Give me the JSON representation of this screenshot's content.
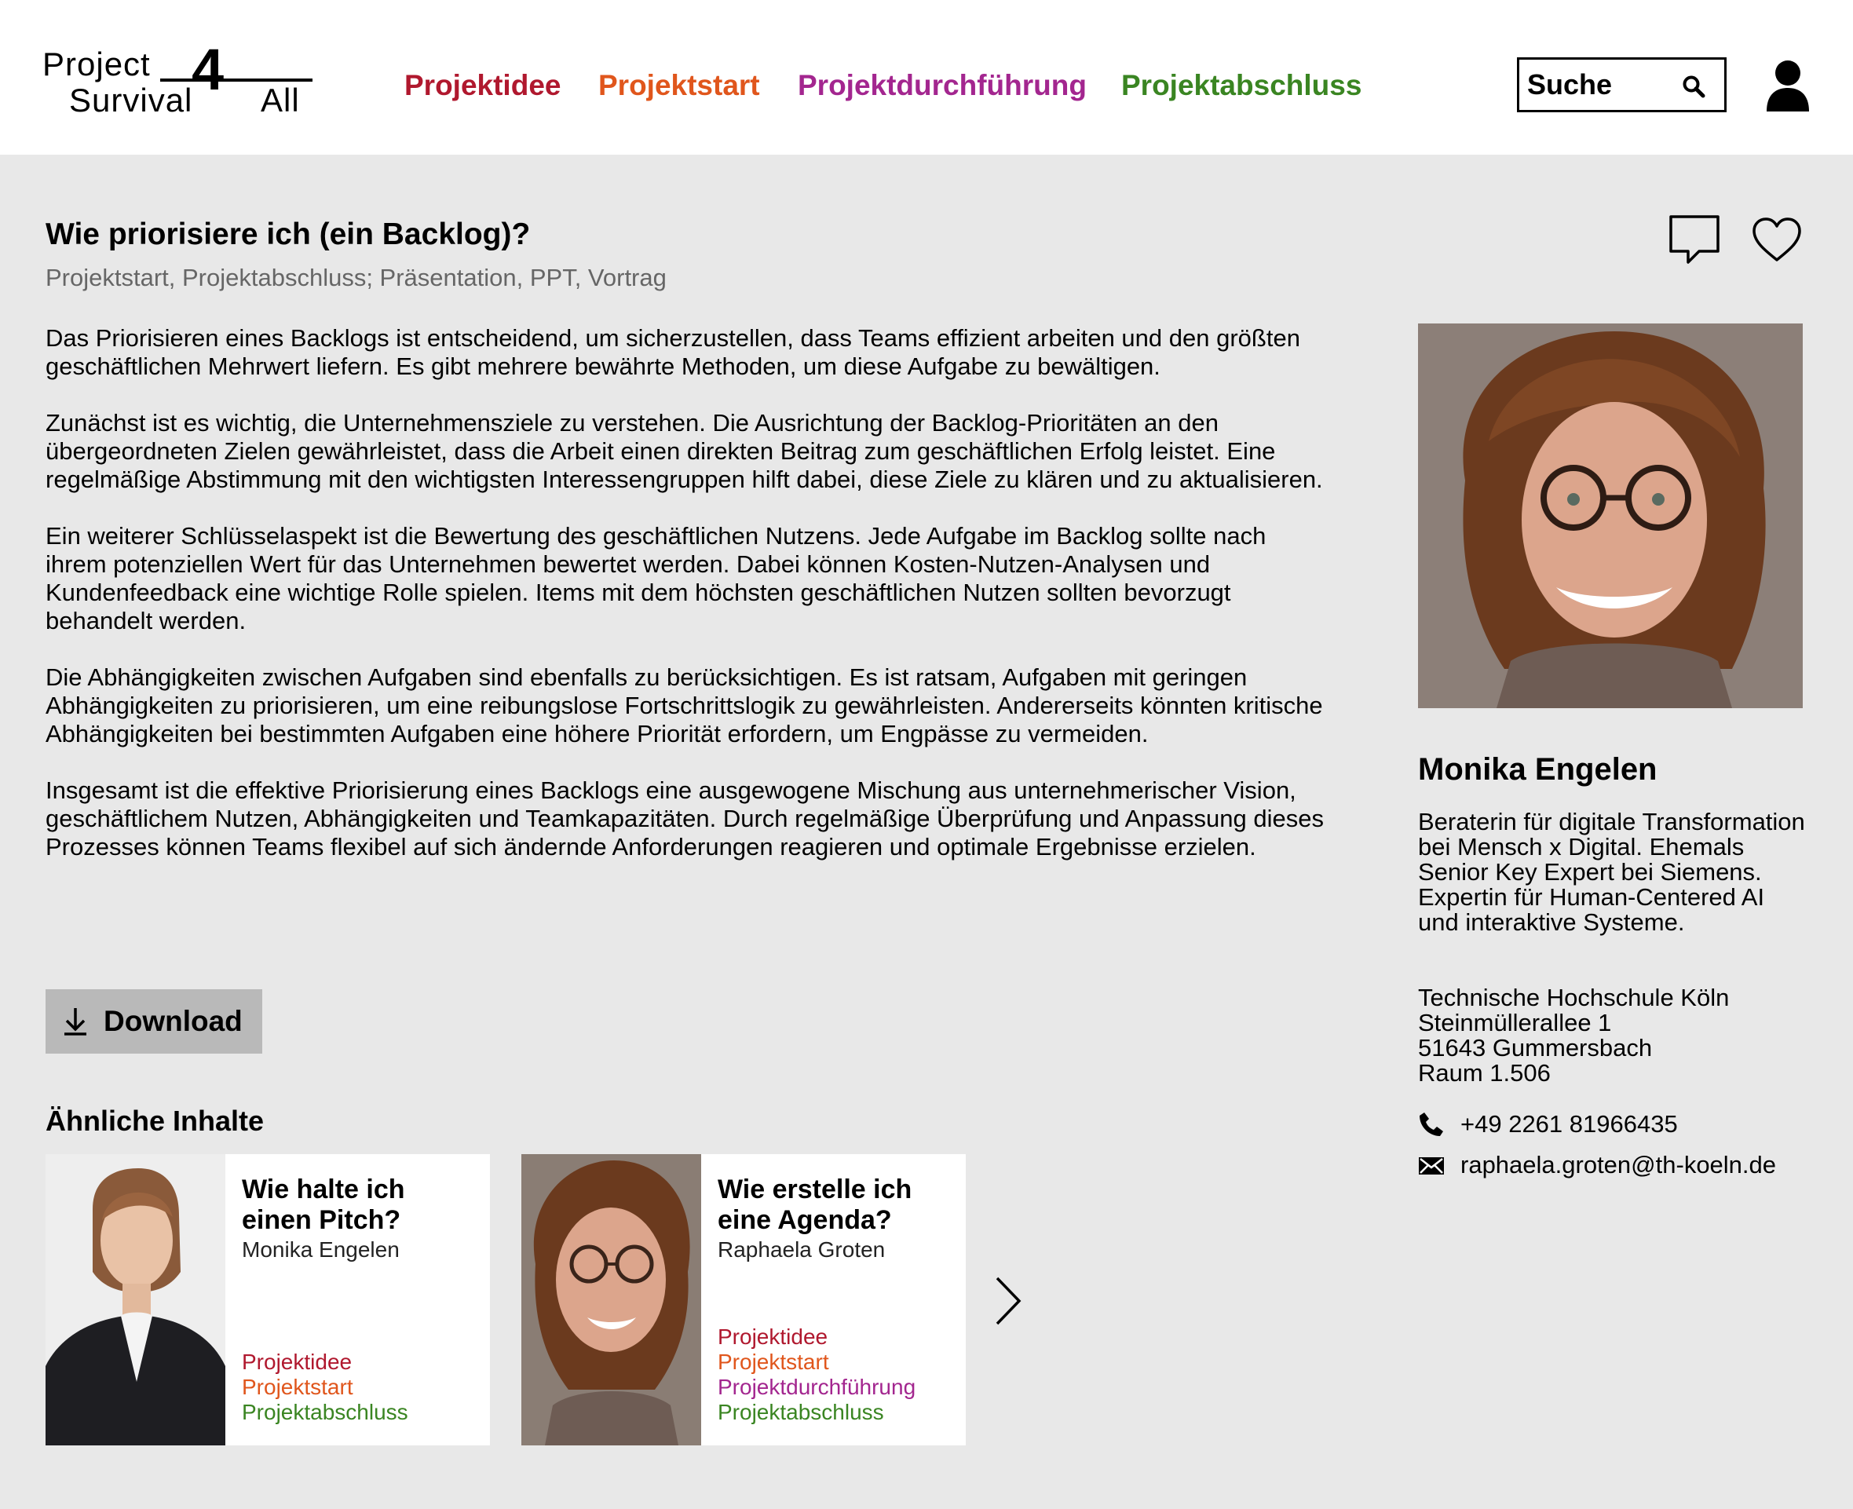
{
  "header": {
    "logo_line1": "Project",
    "logo_digit": "4",
    "logo_line2": "Survival",
    "logo_all": "All",
    "nav": [
      "Projektidee",
      "Projektstart",
      "Projektdurchführung",
      "Projektabschluss"
    ],
    "search_placeholder": "Suche"
  },
  "article": {
    "title": "Wie priorisiere ich (ein Backlog)?",
    "tags": "Projektstart, Projektabschluss; Präsentation, PPT, Vortrag",
    "paragraphs": [
      "Das Priorisieren eines Backlogs ist entscheidend, um sicherzustellen, dass Teams effizient arbeiten und den größten geschäftlichen Mehrwert liefern. Es gibt mehrere bewährte Methoden, um diese Aufgabe zu bewältigen.",
      "Zunächst ist es wichtig, die Unternehmensziele zu verstehen. Die Ausrichtung der Backlog-Prioritäten an den übergeordneten Zielen gewährleistet, dass die Arbeit einen direkten Beitrag zum geschäftlichen Erfolg leistet. Eine regelmäßige Abstimmung mit den wichtigsten Interessengruppen hilft dabei, diese Ziele zu klären und zu aktualisieren.",
      "Ein weiterer Schlüsselaspekt ist die Bewertung des geschäftlichen Nutzens. Jede Aufgabe im Backlog sollte nach ihrem potenziellen Wert für das Unternehmen bewertet werden. Dabei können Kosten-Nutzen-Analysen und Kundenfeedback eine wichtige Rolle spielen. Items mit dem höchsten geschäftlichen Nutzen sollten bevorzugt behandelt werden.",
      "Die Abhängigkeiten zwischen Aufgaben sind ebenfalls zu berücksichtigen. Es ist ratsam, Aufgaben mit geringen Abhängigkeiten zu priorisieren, um eine reibungslose Fortschrittslogik zu gewährleisten. Andererseits könnten kritische Abhängigkeiten bei bestimmten Aufgaben eine höhere Priorität erfordern, um Engpässe zu vermeiden.",
      "Insgesamt ist die effektive Priorisierung eines Backlogs eine ausgewogene Mischung aus unternehmerischer Vision, geschäftlichem Nutzen, Abhängigkeiten und Teamkapazitäten. Durch regelmäßige Überprüfung und Anpassung dieses Prozesses können Teams flexibel auf sich ändernde Anforderungen reagieren und optimale Ergebnisse erzielen."
    ],
    "download_label": "Download"
  },
  "similar": {
    "heading": "Ähnliche Inhalte",
    "cards": [
      {
        "title": "Wie halte ich einen Pitch?",
        "author": "Monika Engelen",
        "tags": [
          "Projektidee",
          "Projektstart",
          "Projektabschluss"
        ]
      },
      {
        "title": "Wie erstelle ich eine Agenda?",
        "author": "Raphaela Groten",
        "tags": [
          "Projektidee",
          "Projektstart",
          "Projektdurchführung",
          "Projektabschluss"
        ]
      }
    ]
  },
  "author": {
    "name": "Monika Engelen",
    "bio": "Beraterin für digitale Transformation bei Mensch x Digital. Ehemals Senior Key Expert bei Siemens. Expertin für Human-Centered AI und interaktive Systeme.",
    "address": [
      "Technische Hochschule Köln",
      "Steinmüllerallee 1",
      "51643 Gummersbach",
      "Raum 1.506"
    ],
    "phone": "+49 2261 81966435",
    "email": "raphaela.groten@th-koeln.de"
  },
  "colors": {
    "projektidee": "#b0182e",
    "projektstart": "#e0561c",
    "projektdurchfuehrung": "#a3268f",
    "projektabschluss": "#3a8522",
    "page_background": "#e8e8e8",
    "download_button": "#b9b9b9"
  },
  "icons": [
    "search-icon",
    "user-icon",
    "comment-icon",
    "heart-icon",
    "download-icon",
    "chevron-right-icon",
    "phone-icon",
    "mail-icon"
  ]
}
